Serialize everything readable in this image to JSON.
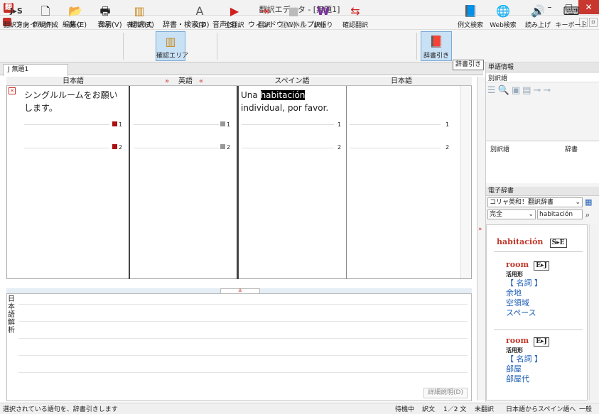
{
  "window": {
    "title": "翻訳エディタ - [無題1]",
    "app_icon": "翻",
    "minimize": "–",
    "maximize": "□",
    "close": "✕"
  },
  "menu": [
    "ファイル(F)",
    "編集(E)",
    "表示(V)",
    "翻訳(T)",
    "辞書・検索(D)",
    "音声(S)",
    "ウィンドウ(W)",
    "ヘルプ(H)"
  ],
  "mdi_buttons": [
    "–",
    "▫"
  ],
  "toolbar": {
    "direction": "翻訳方向",
    "direction_icon_text": "J▸S",
    "new": "新規作成",
    "open": "開く",
    "print": "印刷",
    "view_mode": "表示形式",
    "confirm_area": "確認エリア",
    "font": "文字",
    "translate_all": "全翻訳",
    "translate": "翻訳",
    "stop": "翻訳中止",
    "split": "訳振り",
    "confirm_translate": "確認翻訳",
    "dict_lookup": "辞書引き",
    "example_search": "例文検索",
    "web_search": "Web検索",
    "read_aloud": "読み上げ",
    "keyboard": "キーボード"
  },
  "tooltip": "辞書引き",
  "doc_tab": "J  無題1",
  "columns": {
    "col1": "日本語",
    "col2": "英語",
    "col2_left": "»",
    "col2_right": "«",
    "col3": "スペイン語",
    "col4": "日本語"
  },
  "rows": [
    {
      "ja": "シングルルームをお願いします。",
      "en": "",
      "es_highlight": "habitación",
      "es_pre": "Una ",
      "es_post": "individual, por favor.",
      "ja_back": "",
      "num": "1"
    },
    {
      "num": "2"
    }
  ],
  "analysis": {
    "label": "日本語解析",
    "detail_button": "詳細説明(D)",
    "toggle": "≚"
  },
  "right": {
    "word_info": "単語情報",
    "alt_translations": "別訳語",
    "alt_col1": "別訳語",
    "alt_col2": "辞書",
    "e_dict": "電子辞書",
    "dict_select": "コリャ英和！翻訳辞書",
    "match_select": "完全",
    "query": "habitación",
    "headword": "habitación",
    "headword_tag": "S▸E",
    "entries": [
      {
        "word": "room",
        "tag": "E▸J",
        "form": "活用形",
        "pos": "【 名詞 】",
        "meanings": [
          "余地",
          "空領域",
          "スペース"
        ]
      },
      {
        "word": "room",
        "tag": "E▸J",
        "form": "活用形",
        "pos": "【 名詞 】",
        "meanings": [
          "部屋",
          "部屋代"
        ]
      }
    ]
  },
  "status": {
    "message": "選択されている語句を、辞書引きします",
    "state": "待機中",
    "mode": "訳文",
    "count": "1／2 文",
    "untranslated": "未翻訳",
    "direction": "日本語からスペイン語へ",
    "field": "一般"
  },
  "colors": {
    "close": "#c7372f",
    "accent": "#1a5bb3",
    "headword": "#c0392b",
    "selected": "#c9e1f5"
  }
}
